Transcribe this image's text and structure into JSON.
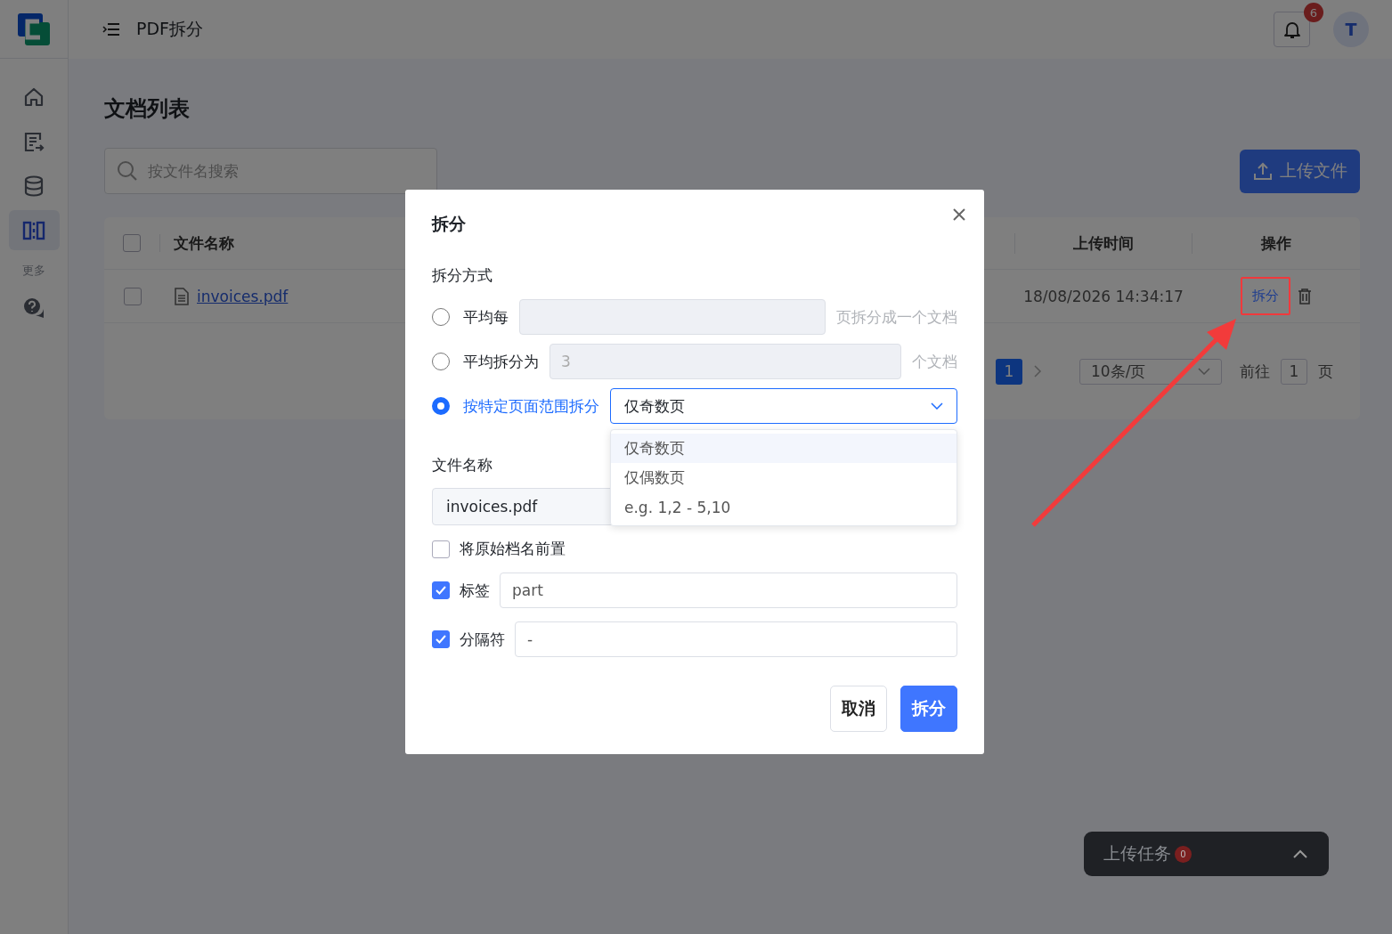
{
  "app": {
    "title": "PDF拆分",
    "notifications": "6",
    "avatar": "T"
  },
  "sidebar": {
    "items": [
      {
        "selected": false
      },
      {
        "selected": false
      },
      {
        "selected": false
      },
      {
        "selected": true
      }
    ],
    "more_label": "更多",
    "extra_items": [
      {
        "selected": false
      }
    ]
  },
  "page": {
    "title": "文档列表",
    "search": {
      "placeholder": "按文件名搜索"
    },
    "upload_button": "上传文件",
    "table": {
      "header_checked": false,
      "columns": [
        "文件名称",
        "上传时间",
        "操作"
      ],
      "rows": [
        {
          "selected": false,
          "name": "invoices.pdf",
          "uploaded": "18/08/2026 14:34:17",
          "actions": [
            "拆分"
          ],
          "highlighted_action": true
        }
      ]
    },
    "pagination": {
      "pages": [
        {
          "label": "1",
          "selected": true
        }
      ],
      "page_size": "10条/页",
      "goto_label": "前往",
      "goto_value": "1",
      "goto_suffix": "页"
    }
  },
  "dialog": {
    "title": "拆分",
    "section_label": "拆分方式",
    "modes": [
      {
        "kind": "input",
        "label": "平均每",
        "selected": false,
        "disabled": true,
        "suffix": "页拆分成一个文档"
      },
      {
        "kind": "input",
        "label": "平均拆分为",
        "selected": false,
        "disabled": true,
        "value": "3",
        "suffix": "个文档"
      },
      {
        "kind": "select",
        "label": "按特定页面范围拆分",
        "selected": true,
        "value": "仅奇数页",
        "expanded": true,
        "options": [
          {
            "label": "仅奇数页",
            "selected": true
          },
          {
            "label": "仅偶数页",
            "selected": false
          },
          {
            "label": "e.g. 1,2 - 5,10",
            "selected": false
          }
        ]
      }
    ],
    "filename_label": "文件名称",
    "filename_value": "invoices.pdf",
    "options": [
      {
        "kind": "check",
        "label": "将原始档名前置",
        "checked": false
      },
      {
        "kind": "check-input",
        "label": "标签",
        "checked": true,
        "value": "part"
      },
      {
        "kind": "check-input",
        "label": "分隔符",
        "checked": true,
        "value": "-"
      }
    ],
    "buttons": [
      {
        "kind": "secondary",
        "label": "取消"
      },
      {
        "kind": "primary",
        "label": "拆分"
      }
    ]
  },
  "upload_tasks": {
    "label": "上传任务",
    "count": "0"
  }
}
